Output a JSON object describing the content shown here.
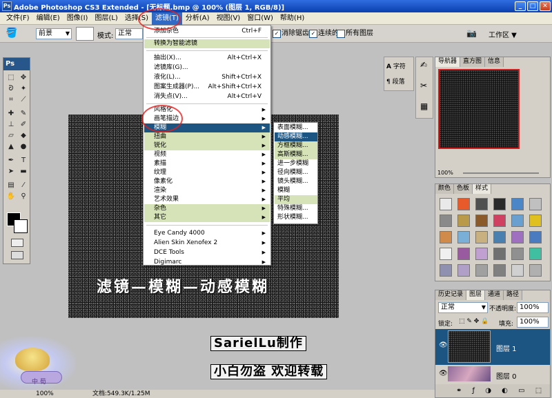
{
  "window": {
    "title": "Adobe Photoshop CS3 Extended - [无标题.bmp @ 100% (图层 1, RGB/8)]",
    "app_icon": "Ps"
  },
  "menubar": [
    "文件(F)",
    "编辑(E)",
    "图像(I)",
    "图层(L)",
    "选择(S)",
    "滤镜(T)",
    "分析(A)",
    "视图(V)",
    "窗口(W)",
    "帮助(H)"
  ],
  "options_bar": {
    "tool_preset": "前景",
    "mode_label": "模式:",
    "mode_value": "正常",
    "antialias": "消除锯齿",
    "contiguous": "连续的",
    "all_layers": "所有图层",
    "workspace": "工作区"
  },
  "filter_menu": {
    "items": [
      {
        "label": "添加杂色",
        "shortcut": "Ctrl+F"
      },
      {
        "label": "转换为智能滤镜",
        "shortcut": ""
      },
      {
        "label": "抽出(X)...",
        "shortcut": "Alt+Ctrl+X"
      },
      {
        "label": "滤镜库(G)...",
        "shortcut": ""
      },
      {
        "label": "液化(L)...",
        "shortcut": "Shift+Ctrl+X"
      },
      {
        "label": "图案生成器(P)...",
        "shortcut": "Alt+Shift+Ctrl+X"
      },
      {
        "label": "消失点(V)...",
        "shortcut": "Alt+Ctrl+V"
      },
      {
        "label": "风格化",
        "shortcut": ""
      },
      {
        "label": "画笔描边",
        "shortcut": ""
      },
      {
        "label": "模糊",
        "shortcut": ""
      },
      {
        "label": "扭曲",
        "shortcut": ""
      },
      {
        "label": "锐化",
        "shortcut": ""
      },
      {
        "label": "视频",
        "shortcut": ""
      },
      {
        "label": "素描",
        "shortcut": ""
      },
      {
        "label": "纹理",
        "shortcut": ""
      },
      {
        "label": "像素化",
        "shortcut": ""
      },
      {
        "label": "渲染",
        "shortcut": ""
      },
      {
        "label": "艺术效果",
        "shortcut": ""
      },
      {
        "label": "杂色",
        "shortcut": ""
      },
      {
        "label": "其它",
        "shortcut": ""
      },
      {
        "label": "Eye Candy 4000",
        "shortcut": ""
      },
      {
        "label": "Alien Skin Xenofex 2",
        "shortcut": ""
      },
      {
        "label": "DCE Tools",
        "shortcut": ""
      },
      {
        "label": "Digimarc",
        "shortcut": ""
      }
    ]
  },
  "blur_submenu": [
    "表面模糊...",
    "动感模糊...",
    "方框模糊...",
    "高斯模糊...",
    "进一步模糊",
    "径向模糊...",
    "镜头模糊...",
    "模糊",
    "平均",
    "特殊模糊...",
    "形状模糊..."
  ],
  "canvas": {
    "caption": "滤镜—模糊—动感模糊"
  },
  "panels": {
    "char_tab": "字符",
    "para_tab": "段落",
    "navigator_tabs": [
      "导航器",
      "直方图",
      "信息"
    ],
    "navigator_zoom": "100%",
    "swatch_tabs": [
      "颜色",
      "色板",
      "样式"
    ],
    "layers_tabs": [
      "历史记录",
      "图层",
      "通道",
      "路径"
    ],
    "blend_mode": "正常",
    "opacity_label": "不透明度:",
    "opacity_value": "100%",
    "lock_label": "锁定:",
    "fill_label": "填充:",
    "fill_value": "100%",
    "layers": [
      "图层 1",
      "图层 0"
    ]
  },
  "status": {
    "zoom": "100%",
    "doc": "文档:549.3K/1.25M"
  },
  "banners": {
    "author": "SarielLu制作",
    "note": "小白勿盗  欢迎转载",
    "logo_text": "中 荀"
  },
  "colors": {
    "menu_highlight": "#d6e3b8",
    "menu_selected": "#1c5582",
    "title_blue": "#0a3fae",
    "ring_red": "#e61e1e"
  }
}
